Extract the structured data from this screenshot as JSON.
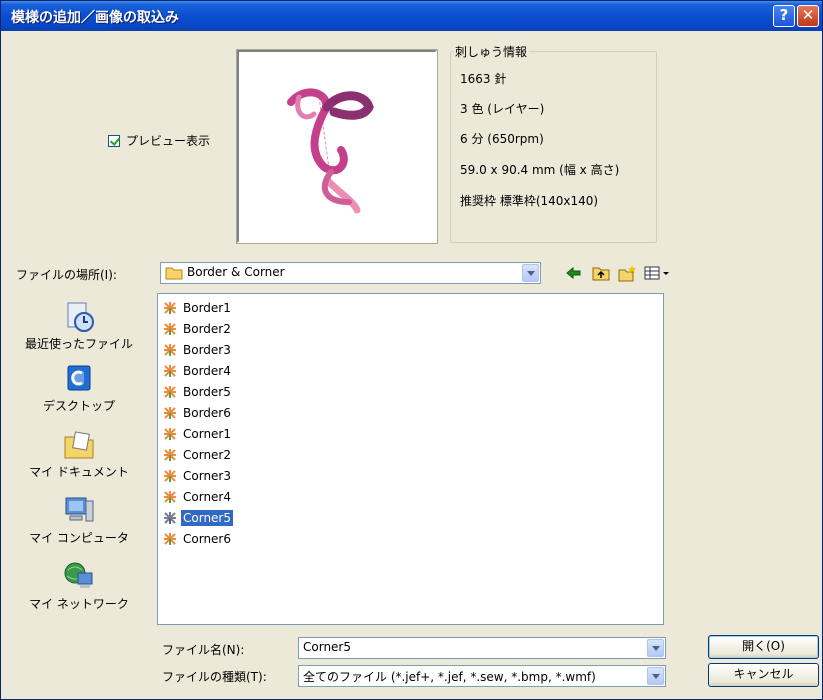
{
  "window": {
    "title": "模様の追加／画像の取込み",
    "help_label": "?",
    "close_label": "✕"
  },
  "preview": {
    "checkbox_label": "プレビュー表示",
    "checked": true
  },
  "info": {
    "legend": "刺しゅう情報",
    "stitches": "1663 針",
    "colors": "3 色 (レイヤー)",
    "time": "6 分 (650rpm)",
    "size": "59.0 x 90.4 mm (幅 x 高さ)",
    "hoop": "推奨枠  標準枠(140x140)"
  },
  "location": {
    "label": "ファイルの場所(I):",
    "value": "Border & Corner"
  },
  "toolbar": {
    "back_icon": "back-arrow-icon",
    "up_icon": "up-folder-icon",
    "new_folder_icon": "new-folder-icon",
    "view_icon": "view-menu-icon"
  },
  "places": [
    {
      "label": "最近使ったファイル",
      "icon": "recent-files-icon"
    },
    {
      "label": "デスクトップ",
      "icon": "desktop-icon"
    },
    {
      "label": "マイ ドキュメント",
      "icon": "my-documents-icon"
    },
    {
      "label": "マイ コンピュータ",
      "icon": "my-computer-icon"
    },
    {
      "label": "マイ ネットワーク",
      "icon": "my-network-icon"
    }
  ],
  "files": [
    {
      "name": "Border1",
      "selected": false
    },
    {
      "name": "Border2",
      "selected": false
    },
    {
      "name": "Border3",
      "selected": false
    },
    {
      "name": "Border4",
      "selected": false
    },
    {
      "name": "Border5",
      "selected": false
    },
    {
      "name": "Border6",
      "selected": false
    },
    {
      "name": "Corner1",
      "selected": false
    },
    {
      "name": "Corner2",
      "selected": false
    },
    {
      "name": "Corner3",
      "selected": false
    },
    {
      "name": "Corner4",
      "selected": false
    },
    {
      "name": "Corner5",
      "selected": true
    },
    {
      "name": "Corner6",
      "selected": false
    }
  ],
  "filename": {
    "label": "ファイル名(N):",
    "value": "Corner5"
  },
  "filetype": {
    "label": "ファイルの種類(T):",
    "value": "全てのファイル (*.jef+, *.jef, *.sew, *.bmp, *.wmf)"
  },
  "buttons": {
    "open": "開く(O)",
    "cancel": "キャンセル"
  },
  "colors": {
    "titlebar": "#0a4fd0",
    "selection": "#316ac5",
    "dialog_bg": "#ece9d8"
  }
}
